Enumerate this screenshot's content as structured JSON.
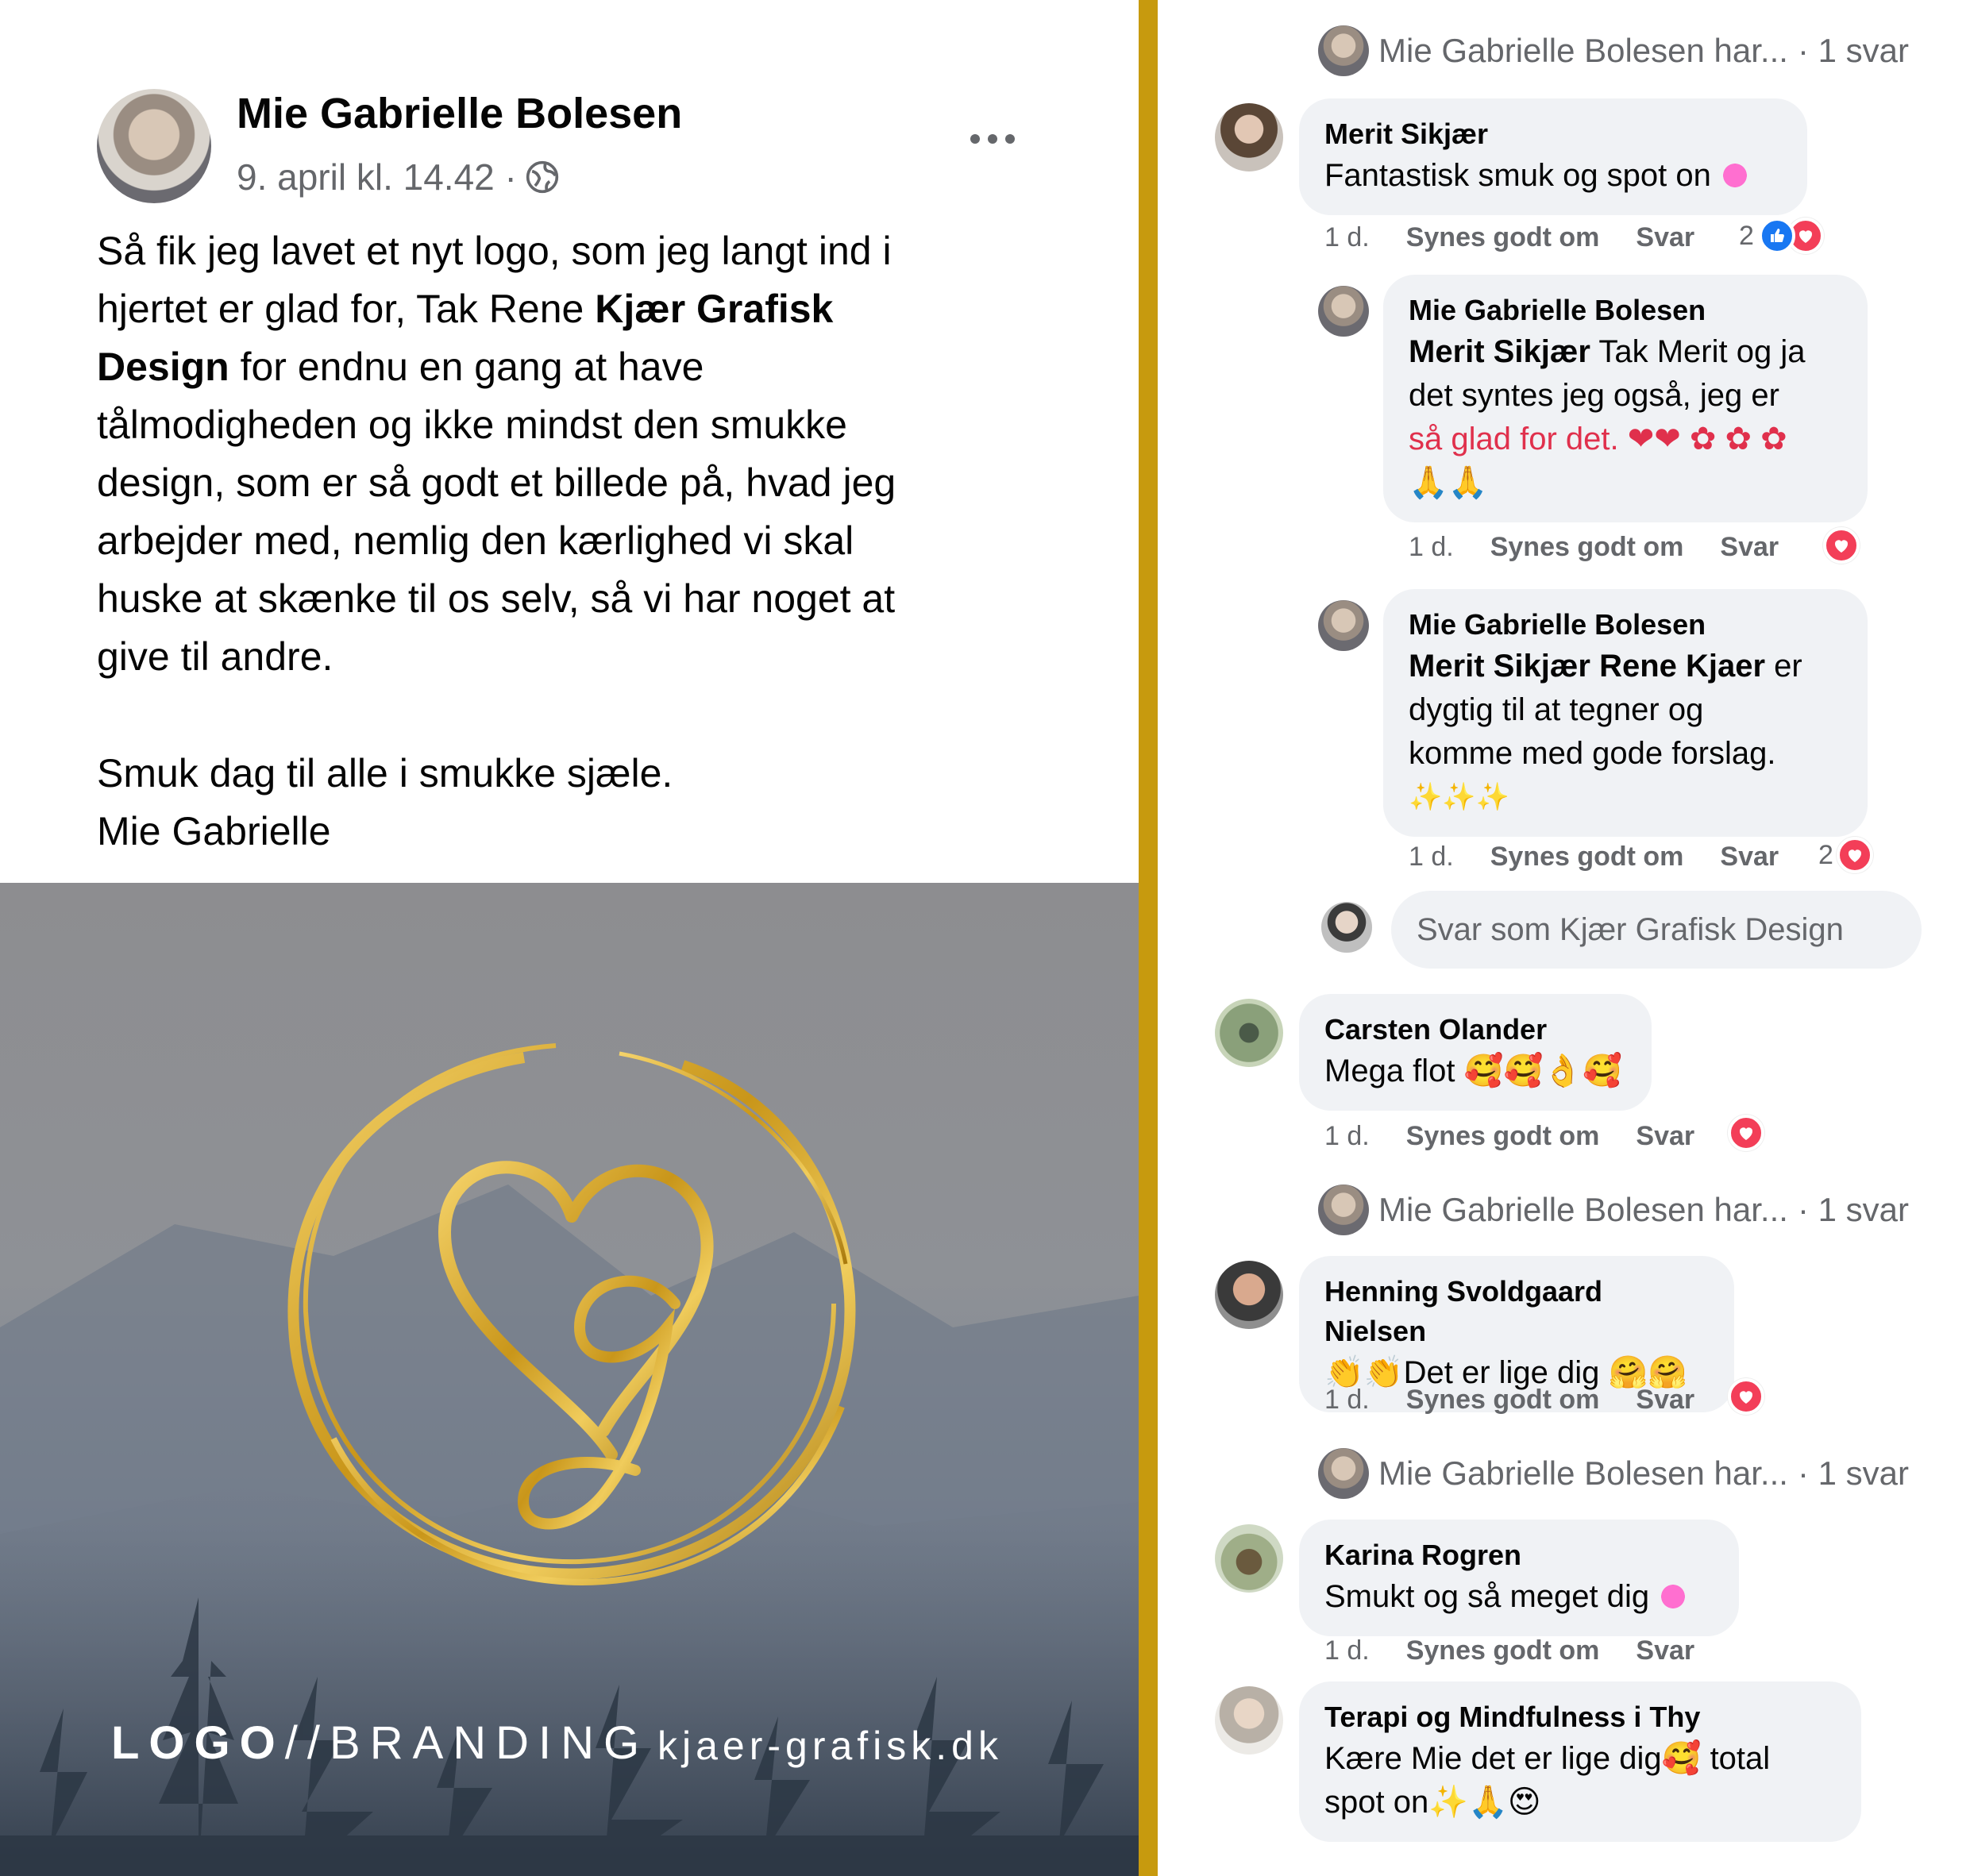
{
  "post": {
    "author": "Mie Gabrielle Bolesen",
    "timestamp": "9. april kl. 14.42 ·",
    "privacy_icon": "globe-icon",
    "more_icon": "more-icon",
    "text_line_1": "Så fik jeg lavet et nyt logo, som jeg langt ind i",
    "text_line_2a": "hjertet er glad for, Tak Rene ",
    "text_line_2b": "Kjær Grafisk",
    "text_line_3a": "Design",
    "text_line_3b": " for endnu en gang at have",
    "text_line_4": "tålmodigheden og ikke mindst den smukke",
    "text_line_5": "design, som er så godt et billede på, hvad jeg",
    "text_line_6": "arbejder med, nemlig den kærlighed vi skal",
    "text_line_7": "huske at skænke til os selv, så vi har noget at",
    "text_line_8": "give til andre.",
    "sign_line_1": "Smuk dag til alle i smukke sjæle.",
    "sign_line_2": "Mie Gabrielle",
    "image": {
      "brand_bold": "LOGO",
      "brand_rest": "//BRANDING",
      "url": "kjaer-grafisk.dk",
      "accent_color": "#c79a0e"
    }
  },
  "comments": {
    "reply_summary_1": {
      "name": "Mie Gabrielle Bolesen har...",
      "count": "· 1 svar"
    },
    "c1": {
      "name": "Merit Sikjær",
      "text": "Fantastisk smuk og spot on",
      "time": "1 d.",
      "like": "Synes godt om",
      "reply": "Svar",
      "reactions": "2"
    },
    "r1": {
      "name": "Mie Gabrielle Bolesen",
      "mention": "Merit Sikjær",
      "text_1": " Tak Merit og ja",
      "text_2": "det syntes jeg også, jeg er",
      "text_3": "så glad for det. ❤❤ ✿ ✿ ✿",
      "text_4": "🙏🙏",
      "time": "1 d.",
      "like": "Synes godt om",
      "reply": "Svar"
    },
    "r2": {
      "name": "Mie Gabrielle Bolesen",
      "mention": "Merit Sikjær Rene Kjaer",
      "text_1": " er",
      "text_2": "dygtig til at tegner og",
      "text_3": "komme med gode forslag.",
      "text_4": "✨✨✨",
      "time": "1 d.",
      "like": "Synes godt om",
      "reply": "Svar",
      "reactions": "2"
    },
    "reply_input_placeholder": "Svar som Kjær Grafisk Design",
    "c2": {
      "name": "Carsten Olander",
      "text": "Mega flot 🥰🥰👌🥰",
      "time": "1 d.",
      "like": "Synes godt om",
      "reply": "Svar"
    },
    "reply_summary_2": {
      "name": "Mie Gabrielle Bolesen har...",
      "count": "· 1 svar"
    },
    "c3": {
      "name": "Henning Svoldgaard Nielsen",
      "text": "👏👏Det er lige dig 🤗🤗",
      "time": "1 d.",
      "like": "Synes godt om",
      "reply": "Svar"
    },
    "reply_summary_3": {
      "name": "Mie Gabrielle Bolesen har...",
      "count": "· 1 svar"
    },
    "c4": {
      "name": "Karina Rogren",
      "text": "Smukt og så meget dig",
      "time": "1 d.",
      "like": "Synes godt om",
      "reply": "Svar"
    },
    "c5": {
      "name": "Terapi og Mindfulness i Thy",
      "text_1": "Kære Mie det er lige dig🥰 total",
      "text_2": "spot on✨🙏😍"
    }
  }
}
